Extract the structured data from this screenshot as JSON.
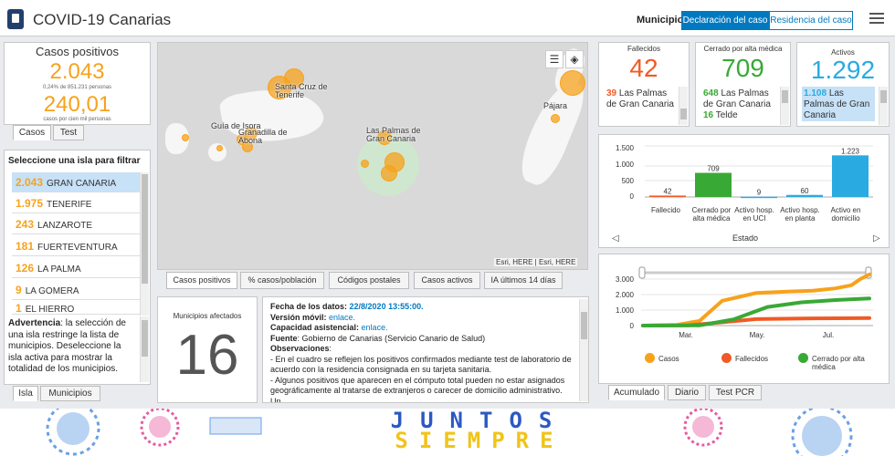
{
  "header": {
    "title": "COVID-19 Canarias",
    "municipio_label": "Municipio",
    "btn_declaracion": "Declaración del caso",
    "btn_residencia": "Residencia del caso"
  },
  "casos_panel": {
    "title": "Casos positivos",
    "value": "2.043",
    "pct": "0,24% de 851.231 personas",
    "rate": "240,01",
    "rate_label": "casos por cien mil personas",
    "tab_casos": "Casos",
    "tab_test": "Test"
  },
  "islands_panel": {
    "header": "Seleccione una isla para filtrar",
    "items": [
      {
        "count": "2.043",
        "name": "GRAN CANARIA"
      },
      {
        "count": "1.975",
        "name": "TENERIFE"
      },
      {
        "count": "243",
        "name": "LANZAROTE"
      },
      {
        "count": "181",
        "name": "FUERTEVENTURA"
      },
      {
        "count": "126",
        "name": "LA PALMA"
      },
      {
        "count": "9",
        "name": "LA GOMERA"
      },
      {
        "count": "1",
        "name": "EL HIERRO"
      }
    ],
    "warning_bold": "Advertencia",
    "warning_text": ": la selección de una isla restringe la lista de municipios. Deseleccione la isla activa para mostrar la totalidad de los municipios.",
    "tab_isla": "Isla",
    "tab_municipios": "Municipios"
  },
  "map": {
    "labels": {
      "santa_cruz": "Santa Cruz de Tenerife",
      "guia": "Guía de Isora",
      "granadilla": "Granadilla de Abona",
      "las_palmas": "Las Palmas de Gran Canaria",
      "pajara": "Pájara"
    },
    "attribution": "Esri, HERE | Esri, HERE"
  },
  "map_tabs": [
    "Casos positivos",
    "% casos/población",
    "Códigos postales",
    "Casos activos",
    "IA últimos 14 días"
  ],
  "municipios": {
    "label": "Municipios afectados",
    "value": "16"
  },
  "info": {
    "fecha_label": "Fecha de los datos: ",
    "fecha_value": "22/8/2020 13:55:00.",
    "movil_label": "Versión móvil: ",
    "movil_link": "enlace.",
    "capacidad_label": "Capacidad asistencial: ",
    "capacidad_link": "enlace.",
    "fuente_label": "Fuente",
    "fuente_text": ": Gobierno de Canarias (Servicio Canario de Salud)",
    "obs_label": "Observaciones",
    "obs_colon": ":",
    "obs1": "- En el cuadro se reflejen los positivos confirmados mediante test de laboratorio de acuerdo con la residencia consignada en su tarjeta sanitaria.",
    "obs2": "- Algunos positivos que aparecen en el cómputo total pueden no estar asignados geográficamente al tratarse de extranjeros o carecer de domicilio administrativo. Un"
  },
  "kpis": {
    "fallecidos": {
      "label": "Fallecidos",
      "value": "42",
      "sub_num": "39",
      "sub_text": "Las Palmas de Gran Canaria",
      "color": "#f15a24"
    },
    "cerrado": {
      "label": "Cerrado por alta médica",
      "value": "709",
      "sub_num": "648",
      "sub_text": "Las Palmas de Gran Canaria",
      "sub2_num": "16",
      "sub2_text": "Telde",
      "color": "#39a935"
    },
    "activos": {
      "label": "Activos",
      "value": "1.292",
      "sub_num": "1.108",
      "sub_text": "Las Palmas de Gran Canaria",
      "color": "#29abe2"
    }
  },
  "bar_chart": {
    "xaxis_label": "Estado",
    "ytick_labels": [
      "1.500",
      "1.000",
      "500",
      "0"
    ]
  },
  "line_chart": {
    "ytick_labels": [
      "3.000",
      "2.000",
      "1.000",
      "0"
    ],
    "xtick_labels": [
      "Mar.",
      "May.",
      "Jul."
    ],
    "legend": [
      "Casos",
      "Fallecidos",
      "Cerrado por alta médica"
    ],
    "tabs": [
      "Acumulado",
      "Diario",
      "Test PCR"
    ]
  },
  "banner": {
    "line1": "JUNTOS",
    "line2": "SIEMPRE"
  },
  "chart_data": [
    {
      "type": "bar",
      "categories": [
        "Fallecido",
        "Cerrado por alta médica",
        "Activo hosp. en UCI",
        "Activo hosp. en planta",
        "Activo en domicilio"
      ],
      "values": [
        42,
        709,
        9,
        60,
        1223
      ],
      "value_labels": [
        "42",
        "709",
        "9",
        "60",
        "1.223"
      ],
      "colors": [
        "#f15a24",
        "#39a935",
        "#29abe2",
        "#29abe2",
        "#29abe2"
      ],
      "xlabel": "Estado",
      "ylim": [
        0,
        1500
      ],
      "yticks": [
        0,
        500,
        1000,
        1500
      ]
    },
    {
      "type": "line",
      "series": [
        {
          "name": "Casos",
          "color": "#f7a21b",
          "points": [
            [
              0,
              0
            ],
            [
              0.15,
              50
            ],
            [
              0.25,
              300
            ],
            [
              0.35,
              1600
            ],
            [
              0.5,
              2100
            ],
            [
              0.65,
              2200
            ],
            [
              0.75,
              2250
            ],
            [
              0.85,
              2400
            ],
            [
              0.92,
              2600
            ],
            [
              0.96,
              3000
            ],
            [
              1,
              5000
            ]
          ]
        },
        {
          "name": "Fallecidos",
          "color": "#f15a24",
          "points": [
            [
              0,
              0
            ],
            [
              0.2,
              10
            ],
            [
              0.3,
              150
            ],
            [
              0.5,
              420
            ],
            [
              0.7,
              460
            ],
            [
              0.85,
              470
            ],
            [
              1,
              480
            ]
          ]
        },
        {
          "name": "Cerrado por alta médica",
          "color": "#39a935",
          "points": [
            [
              0,
              0
            ],
            [
              0.25,
              10
            ],
            [
              0.4,
              400
            ],
            [
              0.55,
              1200
            ],
            [
              0.7,
              1500
            ],
            [
              0.85,
              1650
            ],
            [
              1,
              1750
            ]
          ]
        }
      ],
      "ylim": [
        0,
        3000
      ],
      "yticks": [
        0,
        1000,
        2000,
        3000
      ],
      "xticks": [
        "Mar.",
        "May.",
        "Jul."
      ]
    }
  ]
}
